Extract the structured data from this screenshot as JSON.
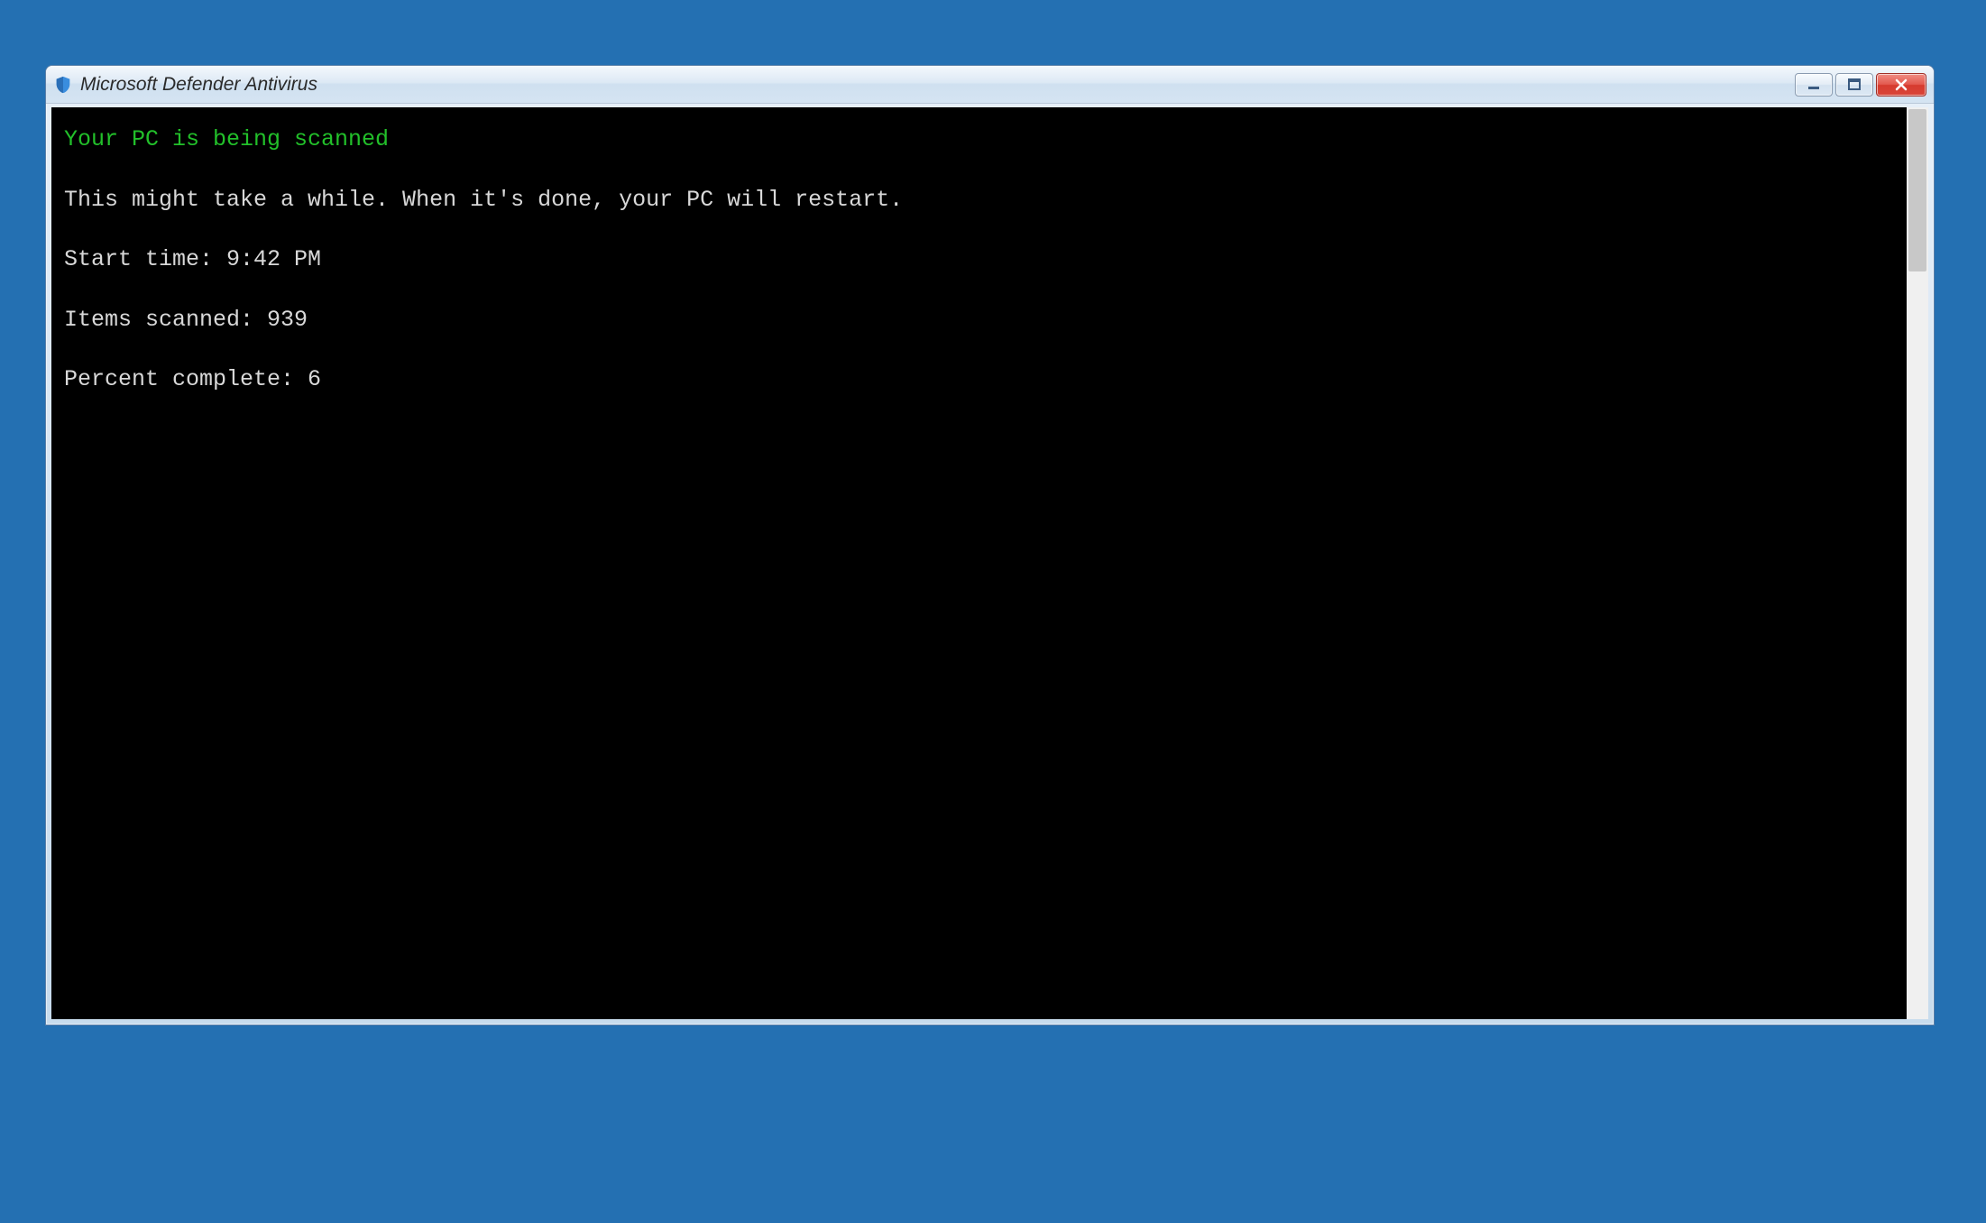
{
  "window": {
    "title": "Microsoft Defender Antivirus"
  },
  "console": {
    "heading": "Your PC is being scanned",
    "info": "This might take a while. When it's done, your PC will restart.",
    "start_time_label": "Start time: ",
    "start_time_value": "9:42 PM",
    "items_label": "Items scanned: ",
    "items_value": "939",
    "percent_label": "Percent complete: ",
    "percent_value": "6"
  }
}
